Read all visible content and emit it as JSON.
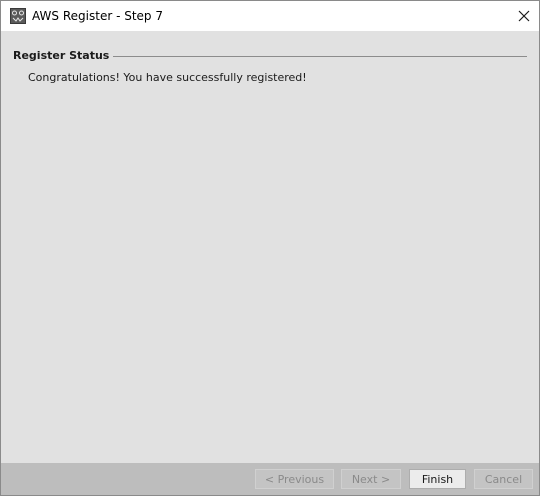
{
  "window": {
    "title": "AWS Register - Step 7",
    "app_icon": "aws-app-icon",
    "close_icon": "close-icon"
  },
  "group": {
    "label": "Register Status"
  },
  "message": "Congratulations! You have successfully registered!",
  "buttons": {
    "previous": {
      "label": "< Previous",
      "enabled": false
    },
    "next": {
      "label": "Next >",
      "enabled": false
    },
    "finish": {
      "label": "Finish",
      "enabled": true
    },
    "cancel": {
      "label": "Cancel",
      "enabled": false
    }
  },
  "colors": {
    "content_bg": "#e1e1e1",
    "footer_bg": "#bdbdbd",
    "titlebar_bg": "#ffffff"
  }
}
